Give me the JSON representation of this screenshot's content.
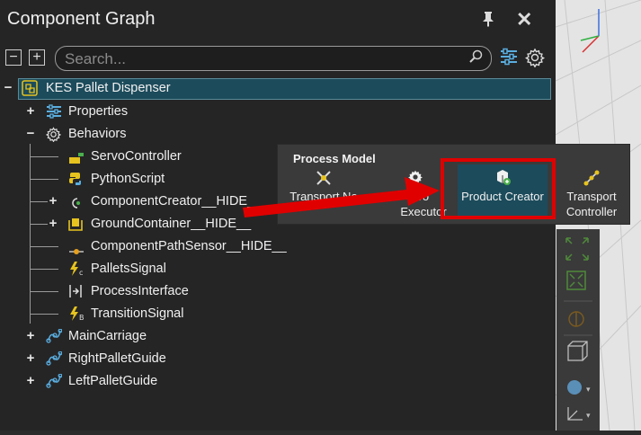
{
  "header": {
    "title": "Component Graph",
    "pin_icon": "pin-icon",
    "close_icon": "close-icon"
  },
  "toolbar": {
    "collapse_label": "−",
    "expand_label": "+",
    "search_placeholder": "Search...",
    "filter_icon": "sliders-icon",
    "settings_icon": "gear-icon"
  },
  "tree": {
    "root": {
      "label": "KES Pallet Dispenser",
      "expander": "−"
    },
    "properties": {
      "label": "Properties",
      "expander": "+"
    },
    "behaviors": {
      "label": "Behaviors",
      "expander": "−",
      "children": [
        {
          "label": "ServoController",
          "expander": ""
        },
        {
          "label": "PythonScript",
          "expander": ""
        },
        {
          "label": "ComponentCreator__HIDE__",
          "expander": "+"
        },
        {
          "label": "GroundContainer__HIDE__",
          "expander": "+"
        },
        {
          "label": "ComponentPathSensor__HIDE__",
          "expander": ""
        },
        {
          "label": "PalletsSignal",
          "expander": ""
        },
        {
          "label": "ProcessInterface",
          "expander": ""
        },
        {
          "label": "TransitionSignal",
          "expander": ""
        }
      ]
    },
    "links": [
      {
        "label": "MainCarriage",
        "expander": "+"
      },
      {
        "label": "RightPalletGuide",
        "expander": "+"
      },
      {
        "label": "LeftPalletGuide",
        "expander": "+"
      }
    ]
  },
  "process_model": {
    "title": "Process Model",
    "buttons": [
      {
        "line1": "Transport No",
        "line2": ""
      },
      {
        "line1": "Pro",
        "line2": "Executor"
      },
      {
        "line1": "Product Creator",
        "line2": ""
      },
      {
        "line1": "Transport",
        "line2": "Controller"
      }
    ]
  },
  "colors": {
    "panel_bg": "#252526",
    "selection_bg": "#1c4b5b",
    "highlight_red": "#e00000",
    "icon_yellow": "#e6c31e",
    "icon_blue": "#5aaee0"
  }
}
